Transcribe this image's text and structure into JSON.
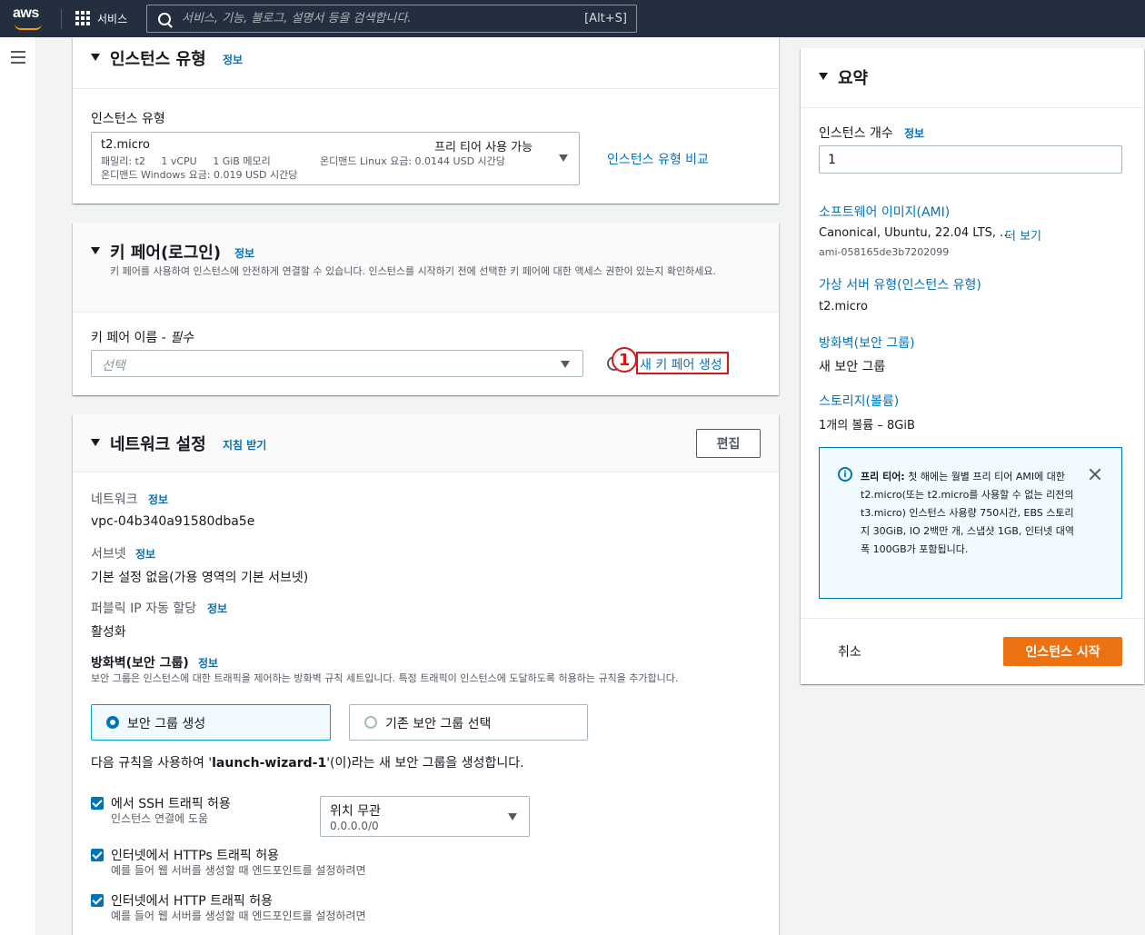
{
  "topnav": {
    "logo_text": "aws",
    "services_label": "서비스",
    "search_placeholder": "서비스, 기능, 블로그, 설명서 등을 검색합니다.",
    "search_shortcut": "[Alt+S]"
  },
  "instance_type": {
    "title": "인스턴스 유형",
    "info": "정보",
    "field_label": "인스턴스 유형",
    "selected": "t2.micro",
    "free_tier": "프리 티어 사용 가능",
    "family_line": "패밀리: t2     1 vCPU     1 GiB 메모리",
    "linux_price": "온디맨드 Linux 요금: 0.0144 USD 시간당",
    "windows_price": "온디맨드 Windows 요금: 0.019 USD 시간당",
    "compare_link": "인스턴스 유형 비교"
  },
  "key_pair": {
    "title": "키 페어(로그인)",
    "info": "정보",
    "description": "키 페어를 사용하여 인스턴스에 안전하게 연결할 수 있습니다. 인스턴스를 시작하기 전에 선택한 키 페어에 대한 액세스 권한이 있는지 확인하세요.",
    "field_label": "키 페어 이름 - ",
    "field_required": "필수",
    "select_placeholder": "선택",
    "new_link": "새 키 페어 생성",
    "annotation": "1"
  },
  "network": {
    "title": "네트워크 설정",
    "guide": "지침 받기",
    "edit": "편집",
    "network_label": "네트워크",
    "network_info": "정보",
    "network_value": "vpc-04b340a91580dba5e",
    "subnet_label": "서브넷",
    "subnet_info": "정보",
    "subnet_value": "기본 설정 없음(가용 영역의 기본 서브넷)",
    "public_ip_label": "퍼블릭 IP 자동 할당",
    "public_ip_info": "정보",
    "public_ip_value": "활성화",
    "firewall_label": "방화벽(보안 그룹)",
    "firewall_info": "정보",
    "firewall_desc": "보안 그룹은 인스턴스에 대한 트래픽을 제어하는 방화벽 규칙 세트입니다. 특정 트래픽이 인스턴스에 도달하도록 허용하는 규칙을 추가합니다.",
    "option_create": "보안 그룹 생성",
    "option_existing": "기존 보안 그룹 선택",
    "rule_text_pre": "다음 규칙을 사용하여 '",
    "rule_text_name": "launch-wizard-1",
    "rule_text_post": "'(이)라는 새 보안 그룹을 생성합니다.",
    "ssh_label": "에서 SSH 트래픽 허용",
    "ssh_desc": "인스턴스 연결에 도움",
    "ssh_source": "위치 무관",
    "ssh_cidr": "0.0.0.0/0",
    "https_label": "인터넷에서 HTTPs 트래픽 허용",
    "https_desc": "예를 들어 웹 서버를 생성할 때 엔드포인트를 설정하려면",
    "http_label": "인터넷에서 HTTP 트래픽 허용",
    "http_desc": "예를 들어 웹 서버를 생성할 때 엔드포인트를 설정하려면"
  },
  "summary": {
    "title": "요약",
    "count_label": "인스턴스 개수",
    "count_info": "정보",
    "count_value": "1",
    "ami_label": "소프트웨어 이미지(AMI)",
    "ami_value": "Canonical, Ubuntu, 22.04 LTS, ...",
    "ami_more": "더 보기",
    "ami_id": "ami-058165de3b7202099",
    "type_label": "가상 서버 유형(인스턴스 유형)",
    "type_value": "t2.micro",
    "firewall_label": "방화벽(보안 그룹)",
    "firewall_value": "새 보안 그룹",
    "storage_label": "스토리지(볼륨)",
    "storage_value": "1개의 볼륨 – 8GiB",
    "alert_bold": "프리 티어:",
    "alert_text": " 첫 해에는 월별 프리 티어 AMI에 대한 t2.micro(또는 t2.micro를 사용할 수 없는 리전의 t3.micro) 인스턴스 사용량 750시간, EBS 스토리지 30GiB, IO 2백만 개, 스냅샷 1GB, 인터넷 대역폭 100GB가 포함됩니다.",
    "cancel": "취소",
    "launch": "인스턴스 시작"
  }
}
